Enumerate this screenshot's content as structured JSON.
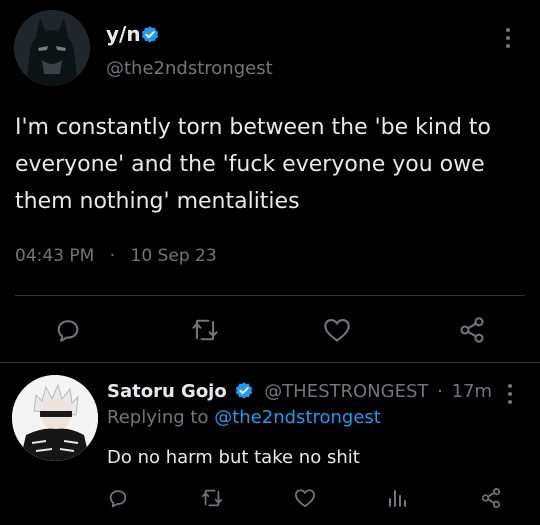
{
  "tweet": {
    "display_name": "y/n",
    "handle": "@the2ndstrongest",
    "text": "I'm constantly torn between the 'be kind to everyone' and the 'fuck everyone you owe them nothing' mentalities",
    "time": "04:43 PM",
    "dot": "·",
    "date": "10 Sep 23",
    "actions": [
      "reply-icon",
      "retweet-icon",
      "like-icon",
      "share-icon"
    ]
  },
  "reply": {
    "display_name": "Satoru Gojo",
    "handle": "@THESTRONGEST",
    "separator": "·",
    "age": "17m",
    "replying_prefix": "Replying to",
    "replying_to": "@the2ndstrongest",
    "text": "Do no harm but take no shit",
    "actions": [
      "reply-icon",
      "retweet-icon",
      "like-icon",
      "views-icon",
      "share-icon"
    ]
  },
  "colors": {
    "background": "#000000",
    "text": "#e7e9ea",
    "muted": "#71767b",
    "accent": "#1d9bf0",
    "divider": "#2f3336"
  }
}
